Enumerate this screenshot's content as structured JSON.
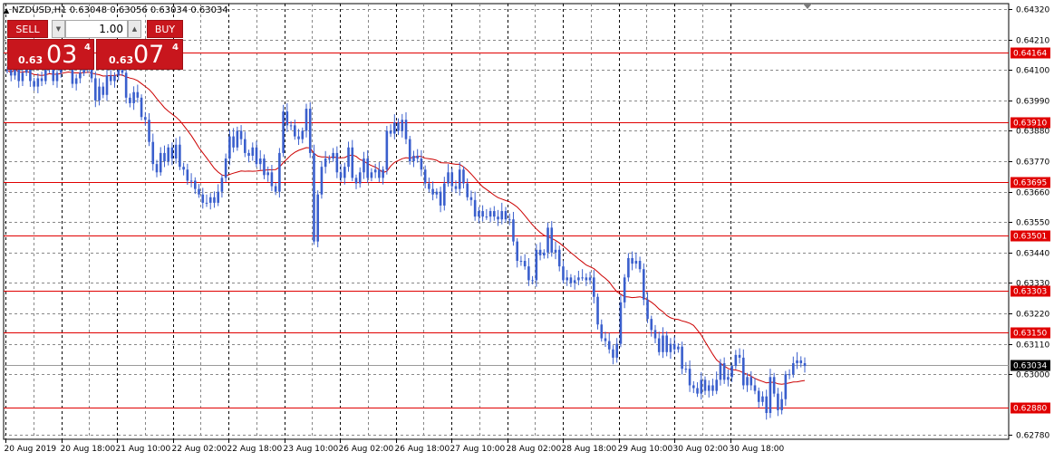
{
  "header": {
    "title": "NZDUSD,H1  0.63048 0.63056 0.63034 0.63034"
  },
  "trade_panel": {
    "sell_label": "SELL",
    "buy_label": "BUY",
    "lot_value": "1.00",
    "sell_price_prefix": "0.63",
    "sell_price_big": "03",
    "sell_price_sup": "4",
    "buy_price_prefix": "0.63",
    "buy_price_big": "07",
    "buy_price_sup": "4",
    "color": "#c8161d"
  },
  "chart_data": {
    "type": "candlestick",
    "symbol": "NZDUSD",
    "timeframe": "H1",
    "ohlc_open": 0.63048,
    "ohlc_high": 0.63056,
    "ohlc_low": 0.63034,
    "ohlc_close": 0.63034,
    "current_price": 0.63034,
    "ylim": [
      0.62765,
      0.6434
    ],
    "y_ticks": [
      "0.64320",
      "0.64210",
      "0.64100",
      "0.63990",
      "0.63880",
      "0.63770",
      "0.63660",
      "0.63550",
      "0.63440",
      "0.63330",
      "0.63220",
      "0.63110",
      "0.63000",
      "0.62780"
    ],
    "x_ticks": [
      "20 Aug 2019",
      "20 Aug 18:00",
      "21 Aug 10:00",
      "22 Aug 02:00",
      "22 Aug 18:00",
      "23 Aug 10:00",
      "26 Aug 02:00",
      "26 Aug 18:00",
      "27 Aug 10:00",
      "28 Aug 02:00",
      "28 Aug 18:00",
      "29 Aug 10:00",
      "30 Aug 02:00",
      "30 Aug 18:00"
    ],
    "horizontal_levels": [
      {
        "label": "0.64164",
        "value": 0.64164
      },
      {
        "label": "0.63910",
        "value": 0.6391
      },
      {
        "label": "0.63695",
        "value": 0.63695
      },
      {
        "label": "0.63501",
        "value": 0.63501
      },
      {
        "label": "0.63303",
        "value": 0.63303
      },
      {
        "label": "0.63150",
        "value": 0.6315
      },
      {
        "label": "0.62880",
        "value": 0.6288
      }
    ],
    "close_series": [
      0.641,
      0.6408,
      0.6413,
      0.6406,
      0.6409,
      0.6411,
      0.6406,
      0.6404,
      0.6407,
      0.6406,
      0.6411,
      0.6413,
      0.6406,
      0.6409,
      0.6412,
      0.6414,
      0.6413,
      0.6405,
      0.6407,
      0.6409,
      0.6412,
      0.6411,
      0.6407,
      0.6399,
      0.6404,
      0.6401,
      0.6408,
      0.6406,
      0.6408,
      0.641,
      0.6409,
      0.64,
      0.6398,
      0.6402,
      0.64,
      0.6393,
      0.6392,
      0.6384,
      0.6376,
      0.6373,
      0.638,
      0.6377,
      0.6382,
      0.6378,
      0.6383,
      0.6375,
      0.6374,
      0.637,
      0.637,
      0.6367,
      0.6365,
      0.6362,
      0.6362,
      0.6364,
      0.6362,
      0.6366,
      0.6371,
      0.6378,
      0.6386,
      0.6382,
      0.6388,
      0.6385,
      0.638,
      0.6379,
      0.6382,
      0.6376,
      0.6378,
      0.6372,
      0.6373,
      0.6368,
      0.6366,
      0.638,
      0.6395,
      0.639,
      0.639,
      0.6386,
      0.6385,
      0.6388,
      0.6396,
      0.638,
      0.6348,
      0.6365,
      0.6375,
      0.6378,
      0.6378,
      0.638,
      0.6373,
      0.6371,
      0.6375,
      0.6382,
      0.6371,
      0.6369,
      0.6373,
      0.6378,
      0.6371,
      0.6373,
      0.6374,
      0.6371,
      0.6374,
      0.6388,
      0.6387,
      0.6391,
      0.6388,
      0.6392,
      0.6385,
      0.6377,
      0.6379,
      0.6378,
      0.6374,
      0.6369,
      0.6367,
      0.6365,
      0.6366,
      0.6361,
      0.6369,
      0.6373,
      0.6368,
      0.6367,
      0.6374,
      0.6369,
      0.6364,
      0.6363,
      0.6357,
      0.6359,
      0.6357,
      0.6357,
      0.6359,
      0.6357,
      0.6356,
      0.6359,
      0.6356,
      0.6356,
      0.6348,
      0.6341,
      0.6341,
      0.6339,
      0.6334,
      0.6334,
      0.6345,
      0.6343,
      0.6344,
      0.6353,
      0.6344,
      0.6345,
      0.6339,
      0.6334,
      0.6335,
      0.6333,
      0.6334,
      0.6335,
      0.6335,
      0.6334,
      0.6335,
      0.6328,
      0.6318,
      0.6313,
      0.6312,
      0.6309,
      0.6306,
      0.6311,
      0.6326,
      0.6335,
      0.6342,
      0.634,
      0.6341,
      0.6338,
      0.6327,
      0.632,
      0.6316,
      0.6313,
      0.6308,
      0.6314,
      0.6308,
      0.6311,
      0.6309,
      0.631,
      0.6302,
      0.6302,
      0.6296,
      0.6295,
      0.6293,
      0.6298,
      0.6294,
      0.6296,
      0.6294,
      0.6298,
      0.6304,
      0.6298,
      0.6299,
      0.6303,
      0.6307,
      0.6306,
      0.6296,
      0.6299,
      0.6296,
      0.6294,
      0.629,
      0.6292,
      0.6286,
      0.6299,
      0.6293,
      0.6287,
      0.6291,
      0.63,
      0.63,
      0.6304,
      0.6305,
      0.6304,
      0.6303
    ]
  },
  "colors": {
    "candle": "#3a5fcd",
    "moving_average": "#cc0000",
    "level_line": "#e00000",
    "grid": "#888888",
    "price_box": "#000000"
  }
}
